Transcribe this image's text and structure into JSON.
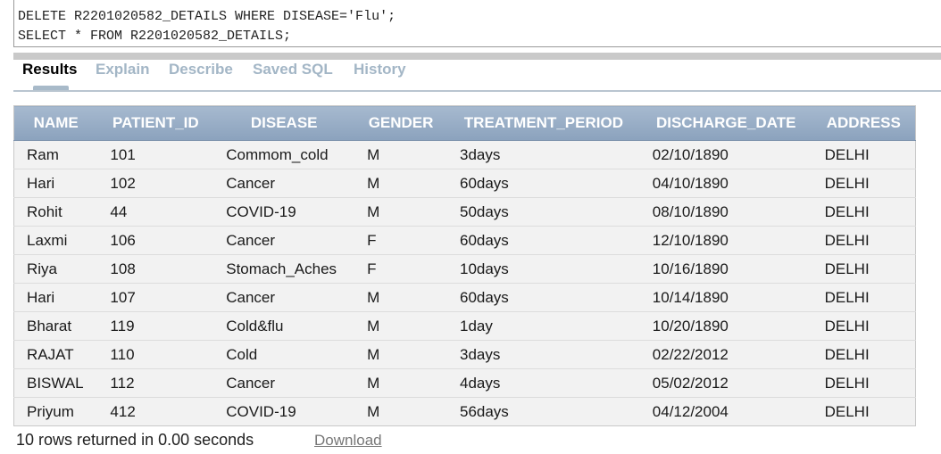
{
  "editor": {
    "lines": [
      "DELETE R2201020582_DETAILS WHERE DISEASE='Flu';",
      "SELECT * FROM R2201020582_DETAILS;"
    ]
  },
  "tabs": [
    {
      "label": "Results",
      "active": true
    },
    {
      "label": "Explain",
      "active": false
    },
    {
      "label": "Describe",
      "active": false
    },
    {
      "label": "Saved SQL",
      "active": false
    },
    {
      "label": "History",
      "active": false
    }
  ],
  "table": {
    "columns": [
      "NAME",
      "PATIENT_ID",
      "DISEASE",
      "GENDER",
      "TREATMENT_PERIOD",
      "DISCHARGE_DATE",
      "ADDRESS"
    ],
    "rows": [
      [
        "Ram",
        "101",
        "Commom_cold",
        "M",
        "3days",
        "02/10/1890",
        "DELHI"
      ],
      [
        "Hari",
        "102",
        "Cancer",
        "M",
        "60days",
        "04/10/1890",
        "DELHI"
      ],
      [
        "Rohit",
        "44",
        "COVID-19",
        "M",
        "50days",
        "08/10/1890",
        "DELHI"
      ],
      [
        "Laxmi",
        "106",
        "Cancer",
        "F",
        "60days",
        "12/10/1890",
        "DELHI"
      ],
      [
        "Riya",
        "108",
        "Stomach_Aches",
        "F",
        "10days",
        "10/16/1890",
        "DELHI"
      ],
      [
        "Hari",
        "107",
        "Cancer",
        "M",
        "60days",
        "10/14/1890",
        "DELHI"
      ],
      [
        "Bharat",
        "119",
        "Cold&flu",
        "M",
        "1day",
        "10/20/1890",
        "DELHI"
      ],
      [
        "RAJAT",
        "110",
        "Cold",
        "M",
        "3days",
        "02/22/2012",
        "DELHI"
      ],
      [
        "BISWAL",
        "112",
        "Cancer",
        "M",
        "4days",
        "05/02/2012",
        "DELHI"
      ],
      [
        "Priyum",
        "412",
        "COVID-19",
        "M",
        "56days",
        "04/12/2004",
        "DELHI"
      ]
    ]
  },
  "footer": {
    "status": "10 rows returned in 0.00 seconds",
    "download_label": "Download"
  },
  "colors": {
    "header_bg": "#97acc6",
    "tab_inactive": "#a3b6c6",
    "row_bg": "#f2f2f2"
  }
}
